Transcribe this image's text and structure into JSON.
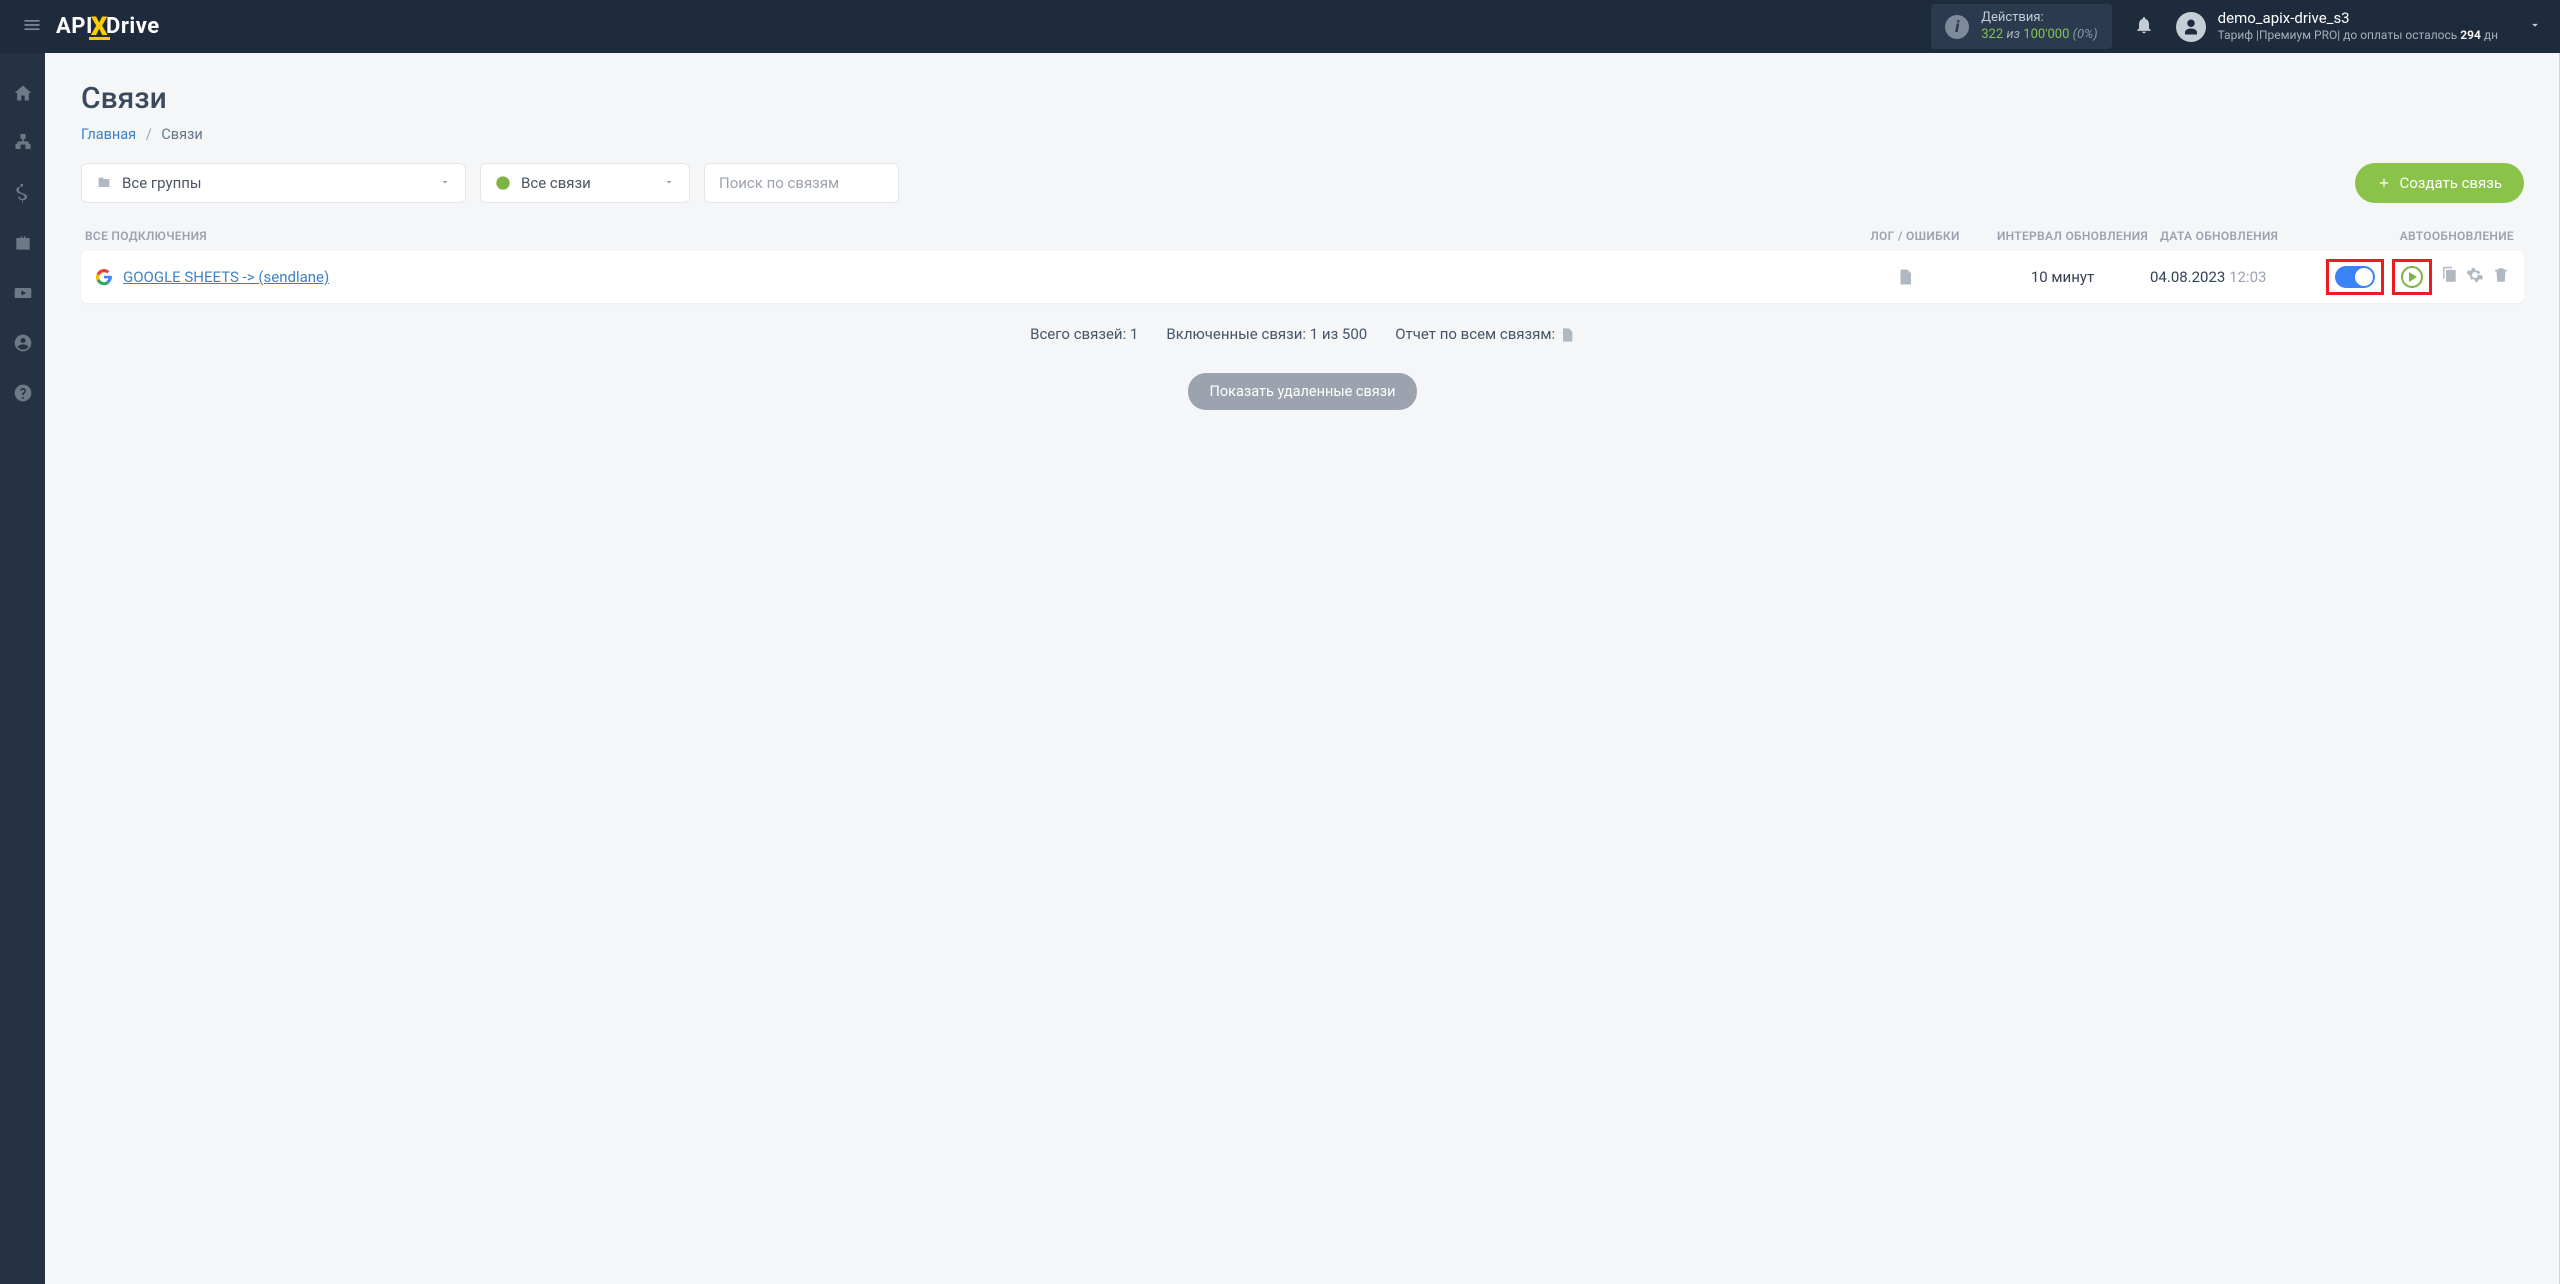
{
  "header": {
    "brand_left": "API",
    "brand_right": "Drive",
    "actions_label": "Действия:",
    "actions_used": "322",
    "actions_of": "из",
    "actions_cap": "100'000",
    "actions_pct": "(0%)",
    "user_name": "demo_apix-drive_s3",
    "plan_prefix": "Тариф |Премиум PRO| до оплаты осталось ",
    "plan_days": "294",
    "plan_suffix": " дн"
  },
  "page": {
    "title": "Связи",
    "breadcrumb_home": "Главная",
    "breadcrumb_sep": "/",
    "breadcrumb_current": "Связи"
  },
  "filters": {
    "groups_label": "Все группы",
    "connections_label": "Все связи",
    "search_placeholder": "Поиск по связям",
    "create_button": "Создать связь"
  },
  "columns": {
    "name": "ВСЕ ПОДКЛЮЧЕНИЯ",
    "log": "ЛОГ / ОШИБКИ",
    "interval": "ИНТЕРВАЛ ОБНОВЛЕНИЯ",
    "date": "ДАТА ОБНОВЛЕНИЯ",
    "auto": "АВТООБНОВЛЕНИЕ"
  },
  "rows": [
    {
      "name": "GOOGLE SHEETS -> (sendlane)",
      "interval": "10 минут",
      "date": "04.08.2023",
      "time": "12:03"
    }
  ],
  "footer": {
    "total": "Всего связей: 1",
    "enabled": "Включенные связи: 1 из 500",
    "report": "Отчет по всем связям:",
    "show_deleted": "Показать удаленные связи"
  }
}
